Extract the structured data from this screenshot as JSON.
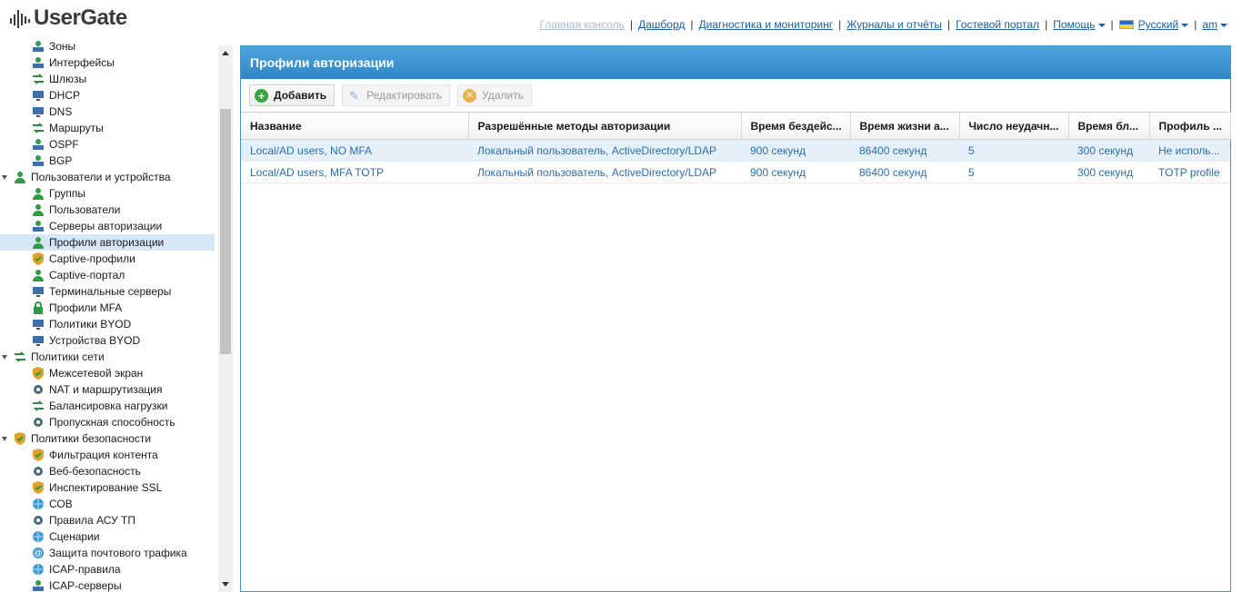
{
  "app": {
    "logo_text": "UserGate"
  },
  "topnav": {
    "items": [
      {
        "label": "Главная консоль",
        "disabled": true
      },
      {
        "label": "Дашборд"
      },
      {
        "label": "Диагностика и мониторинг"
      },
      {
        "label": "Журналы и отчёты"
      },
      {
        "label": "Гостевой портал"
      },
      {
        "label": "Помощь",
        "dropdown": true
      },
      {
        "label": "Русский",
        "dropdown": true,
        "icon": "flag-icon"
      },
      {
        "label": "am",
        "dropdown": true
      }
    ]
  },
  "sidebar": {
    "items": [
      {
        "label": "Зоны",
        "level": "child",
        "icon": "zones-icon"
      },
      {
        "label": "Интерфейсы",
        "level": "child",
        "icon": "interfaces-icon"
      },
      {
        "label": "Шлюзы",
        "level": "child",
        "icon": "gateways-icon"
      },
      {
        "label": "DHCP",
        "level": "child",
        "icon": "dhcp-icon"
      },
      {
        "label": "DNS",
        "level": "child",
        "icon": "dns-icon"
      },
      {
        "label": "Маршруты",
        "level": "child",
        "icon": "routes-icon"
      },
      {
        "label": "OSPF",
        "level": "child",
        "icon": "ospf-icon"
      },
      {
        "label": "BGP",
        "level": "child",
        "icon": "bgp-icon"
      },
      {
        "label": "Пользователи и устройства",
        "level": "group",
        "icon": "users-devices-icon"
      },
      {
        "label": "Группы",
        "level": "child",
        "icon": "groups-icon"
      },
      {
        "label": "Пользователи",
        "level": "child",
        "icon": "user-icon"
      },
      {
        "label": "Серверы авторизации",
        "level": "child",
        "icon": "auth-server-icon"
      },
      {
        "label": "Профили авторизации",
        "level": "child",
        "icon": "auth-profile-icon",
        "selected": true
      },
      {
        "label": "Captive-профили",
        "level": "child",
        "icon": "captive-profile-icon"
      },
      {
        "label": "Captive-портал",
        "level": "child",
        "icon": "captive-portal-icon"
      },
      {
        "label": "Терминальные серверы",
        "level": "child",
        "icon": "terminal-server-icon"
      },
      {
        "label": "Профили MFA",
        "level": "child",
        "icon": "mfa-profile-icon"
      },
      {
        "label": "Политики BYOD",
        "level": "child",
        "icon": "byod-policy-icon"
      },
      {
        "label": "Устройства BYOD",
        "level": "child",
        "icon": "byod-device-icon"
      },
      {
        "label": "Политики сети",
        "level": "group",
        "icon": "network-policies-icon"
      },
      {
        "label": "Межсетевой экран",
        "level": "child",
        "icon": "firewall-icon"
      },
      {
        "label": "NAT и маршрутизация",
        "level": "child",
        "icon": "nat-icon"
      },
      {
        "label": "Балансировка нагрузки",
        "level": "child",
        "icon": "load-balancing-icon"
      },
      {
        "label": "Пропускная способность",
        "level": "child",
        "icon": "bandwidth-icon"
      },
      {
        "label": "Политики безопасности",
        "level": "group",
        "icon": "security-policies-icon"
      },
      {
        "label": "Фильтрация контента",
        "level": "child",
        "icon": "content-filter-icon"
      },
      {
        "label": "Веб-безопасность",
        "level": "child",
        "icon": "web-security-icon"
      },
      {
        "label": "Инспектирование SSL",
        "level": "child",
        "icon": "ssl-inspection-icon"
      },
      {
        "label": "СОВ",
        "level": "child",
        "icon": "ids-icon"
      },
      {
        "label": "Правила АСУ ТП",
        "level": "child",
        "icon": "scada-rules-icon"
      },
      {
        "label": "Сценарии",
        "level": "child",
        "icon": "scenarios-icon"
      },
      {
        "label": "Защита почтового трафика",
        "level": "child",
        "icon": "mail-protection-icon"
      },
      {
        "label": "ICAP-правила",
        "level": "child",
        "icon": "icap-rules-icon"
      },
      {
        "label": "ICAP-серверы",
        "level": "child",
        "icon": "icap-servers-icon"
      }
    ]
  },
  "main": {
    "title": "Профили авторизации",
    "toolbar": {
      "add_label": "Добавить",
      "edit_label": "Редактировать",
      "delete_label": "Удалить"
    },
    "table": {
      "columns": [
        "Название",
        "Разрешённые методы авторизации",
        "Время бездейс...",
        "Время жизни а...",
        "Число неудачн...",
        "Время бл...",
        "Профиль ..."
      ],
      "rows": [
        [
          "Local/AD users, NO MFA",
          "Локальный пользователь, ActiveDirectory/LDAP",
          "900 секунд",
          "86400 секунд",
          "5",
          "300 секунд",
          "Не исполь..."
        ],
        [
          "Local/AD users, MFA TOTP",
          "Локальный пользователь, ActiveDirectory/LDAP",
          "900 секунд",
          "86400 секунд",
          "5",
          "300 секунд",
          "TOTP profile"
        ]
      ]
    }
  },
  "colors": {
    "accent": "#2f86c4",
    "link": "#1a5fa8",
    "selected_row": "#d6e7f5",
    "add_green": "#37a33e"
  }
}
